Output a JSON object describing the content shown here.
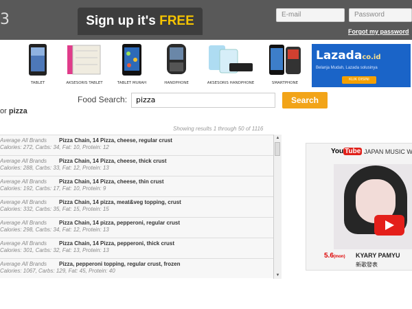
{
  "header": {
    "logo_fragment": "3",
    "signup_text": "Sign up it's ",
    "signup_free": "FREE",
    "email_placeholder": "E-mail",
    "password_placeholder": "Password",
    "forgot_password": "Forgot my password"
  },
  "ad_strip": {
    "products": [
      {
        "label": "TABLET",
        "icon": "tablet-icon"
      },
      {
        "label": "AKSESORIS TABLET",
        "icon": "tablet-case-icon"
      },
      {
        "label": "TABLET MURAH",
        "icon": "tablet-icon"
      },
      {
        "label": "HANDPHONE",
        "icon": "phone-icon"
      },
      {
        "label": "AKSESORIS HANDPHONE",
        "icon": "power-bank-icon"
      },
      {
        "label": "SMARTPHONE",
        "icon": "smartphone-icon"
      }
    ],
    "lazada": {
      "brand": "Lazada",
      "domain": "co.id",
      "tagline": "Belanja Mudah, Lazada solusinya",
      "button": "KLIK DISINI"
    }
  },
  "search": {
    "label": "Food Search:",
    "value": "pizza",
    "button": "Search"
  },
  "results": {
    "for_prefix": "or ",
    "query": "pizza",
    "showing": "Showing results 1 through 50 of 1116",
    "rows": [
      {
        "brand": "Average All Brands",
        "name": "Pizza Chain, 14 Pizza, cheese, regular crust",
        "nutrition": "Calories: 272, Carbs: 34, Fat: 10, Protein: 12"
      },
      {
        "brand": "Average All Brands",
        "name": "Pizza Chain, 14 Pizza, cheese, thick crust",
        "nutrition": "Calories: 288, Carbs: 33, Fat: 12, Protein: 13"
      },
      {
        "brand": "Average All Brands",
        "name": "Pizza Chain, 14 Pizza, cheese, thin crust",
        "nutrition": "Calories: 192, Carbs: 17, Fat: 10, Protein: 9"
      },
      {
        "brand": "Average All Brands",
        "name": "Pizza Chain, 14 pizza, meat&veg topping, crust",
        "nutrition": "Calories: 332, Carbs: 35, Fat: 15, Protein: 15"
      },
      {
        "brand": "Average All Brands",
        "name": "Pizza Chain, 14 pizza, pepperoni, regular crust",
        "nutrition": "Calories: 298, Carbs: 34, Fat: 12, Protein: 13"
      },
      {
        "brand": "Average All Brands",
        "name": "Pizza Chain, 14 Pizza, pepperoni, thick crust",
        "nutrition": "Calories: 301, Carbs: 32, Fat: 13, Protein: 13"
      },
      {
        "brand": "Average All Brands",
        "name": "Pizza, pepperoni topping, regular crust, frozen",
        "nutrition": "Calories: 1067, Carbs: 129, Fat: 45, Protein: 40"
      }
    ]
  },
  "youtube_ad": {
    "logo_you": "You",
    "logo_tube": "Tube",
    "title": "JAPAN MUSIC W",
    "date": "5.6",
    "date_suffix": "(mon)",
    "artist": "KYARY PAMYU",
    "jp_text": "新歌發表"
  }
}
